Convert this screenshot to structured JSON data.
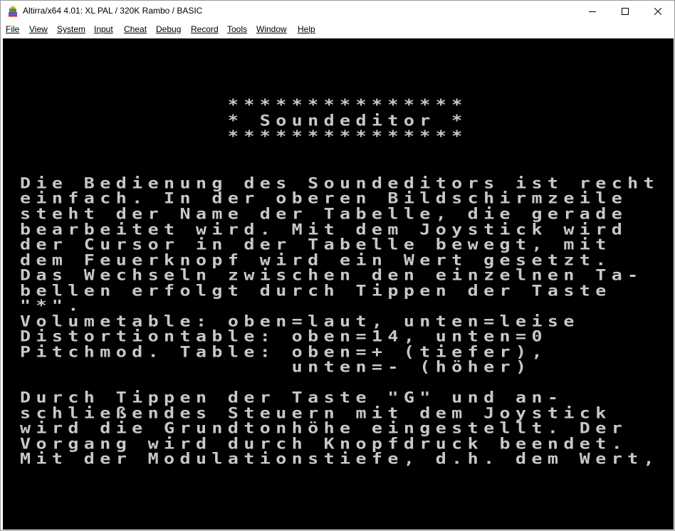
{
  "window": {
    "title": "Altirra/x64 4.01: XL PAL / 320K Rambo / BASIC",
    "icon": "altirra-app-icon"
  },
  "controls": {
    "minimize": "minimize-icon",
    "maximize": "maximize-icon",
    "close": "close-icon"
  },
  "menu": [
    {
      "label": "File"
    },
    {
      "label": "View"
    },
    {
      "label": "System"
    },
    {
      "label": "Input"
    },
    {
      "label": "Cheat"
    },
    {
      "label": "Debug"
    },
    {
      "label": "Record"
    },
    {
      "label": "Tools"
    },
    {
      "label": "Window"
    },
    {
      "label": "Help"
    }
  ],
  "screen": {
    "background": "#000000",
    "text_color": "#c8c8c8",
    "lines": [
      "",
      "",
      "",
      "             ***************",
      "             * Soundeditor *",
      "             ***************",
      "",
      "",
      "Die Bedienung des Soundeditors ist recht",
      "einfach. In der oberen Bildschirmzeile",
      "steht der Name der Tabelle, die gerade",
      "bearbeitet wird. Mit dem Joystick wird",
      "der Cursor in der Tabelle bewegt, mit",
      "dem Feuerknopf wird ein Wert gesetzt.",
      "Das Wechseln zwischen den einzelnen Ta-",
      "bellen erfolgt durch Tippen der Taste",
      "\"*\".",
      "Volumetable: oben=laut, unten=leise",
      "Distortiontable: oben=14, unten=0",
      "Pitchmod. Table: oben=+ (tiefer),",
      "                 unten=- (höher)",
      "",
      "Durch Tippen der Taste \"G\" und an-",
      "schließendes Steuern mit dem Joystick",
      "wird die Grundtonhöhe eingestellt. Der",
      "Vorgang wird durch Knopfdruck beendet.",
      "Mit der Modulationstiefe, d.h. dem Wert,",
      "",
      "",
      ""
    ]
  }
}
